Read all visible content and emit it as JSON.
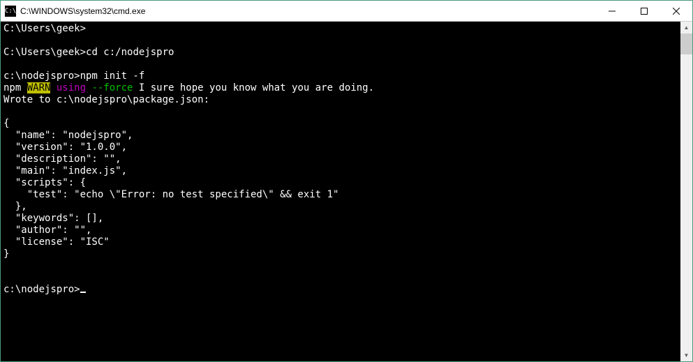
{
  "window": {
    "title": "C:\\WINDOWS\\system32\\cmd.exe",
    "icon_label": "C:\\"
  },
  "terminal": {
    "line1_prompt": "C:\\Users\\geek>",
    "line2_prompt": "C:\\Users\\geek>",
    "line2_cmd": "cd c:/nodejspro",
    "line3_prompt": "c:\\nodejspro>",
    "line3_cmd": "npm init -f",
    "warn_prefix": "npm ",
    "warn_label": "WARN",
    "warn_using": " using",
    "warn_flag": " --force",
    "warn_msg": " I sure hope you know what you are doing.",
    "wrote_line": "Wrote to c:\\nodejspro\\package.json:",
    "json_open": "{",
    "json_name": "  \"name\": \"nodejspro\",",
    "json_version": "  \"version\": \"1.0.0\",",
    "json_description": "  \"description\": \"\",",
    "json_main": "  \"main\": \"index.js\",",
    "json_scripts_open": "  \"scripts\": {",
    "json_test": "    \"test\": \"echo \\\"Error: no test specified\\\" && exit 1\"",
    "json_scripts_close": "  },",
    "json_keywords": "  \"keywords\": [],",
    "json_author": "  \"author\": \"\",",
    "json_license": "  \"license\": \"ISC\"",
    "json_close": "}",
    "final_prompt": "c:\\nodejspro>"
  }
}
